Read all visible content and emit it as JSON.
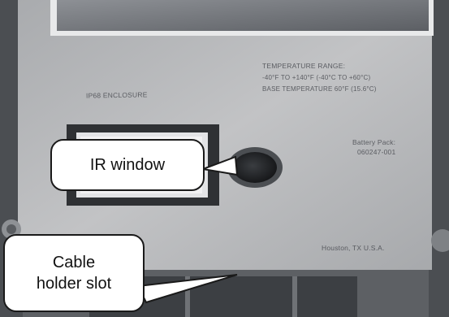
{
  "device_text": {
    "enclosure_rating": "IP68 ENCLOSURE",
    "temperature_range_title": "TEMPERATURE RANGE:",
    "temperature_range_values": "-40°F TO +140°F (-40°C TO +60°C)",
    "base_temperature": "BASE TEMPERATURE 60°F (15.6°C)",
    "battery_pack_label": "Battery Pack:",
    "battery_pack_part": "060247-001",
    "origin": "Houston, TX U.S.A."
  },
  "callouts": {
    "ir_window": "IR window",
    "cable_holder_line1": "Cable",
    "cable_holder_line2": "holder slot"
  },
  "colors": {
    "device_panel": "#b6b7b9",
    "device_frame": "#6f7277",
    "ir_window": "#2a2c2f",
    "callout_border": "#1a1a1a"
  }
}
